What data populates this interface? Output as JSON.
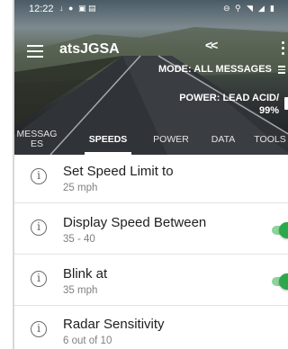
{
  "status_bar": {
    "time": "12:22",
    "left_icons": [
      "notification-icon",
      "vpn-icon",
      "image-icon",
      "message-icon"
    ],
    "right_icons": [
      "do-not-disturb-icon",
      "location-icon",
      "wifi-icon",
      "signal-icon",
      "battery-icon"
    ]
  },
  "app_bar": {
    "title": "atsJGSA",
    "back_label": "<<",
    "mode_label": "MODE: ALL MESSAGES",
    "power_label": "POWER: LEAD ACID/",
    "power_percent": "99%"
  },
  "tabs": [
    {
      "label": "MESSAG ES",
      "active": false
    },
    {
      "label": "SPEEDS",
      "active": true
    },
    {
      "label": "POWER",
      "active": false
    },
    {
      "label": "DATA",
      "active": false
    },
    {
      "label": "TOOLS",
      "active": false
    }
  ],
  "settings": [
    {
      "title": "Set Speed Limit to",
      "value": "25 mph",
      "toggle": null
    },
    {
      "title": "Display Speed Between",
      "value": "35 - 40",
      "toggle": true
    },
    {
      "title": "Blink at",
      "value": "35 mph",
      "toggle": true
    },
    {
      "title": "Radar Sensitivity",
      "value": "6 out of 10",
      "toggle": null
    }
  ],
  "colors": {
    "toggle_on": "#2ba84a",
    "toggle_track": "#8dd39b",
    "tab_indicator": "#ffffff"
  }
}
